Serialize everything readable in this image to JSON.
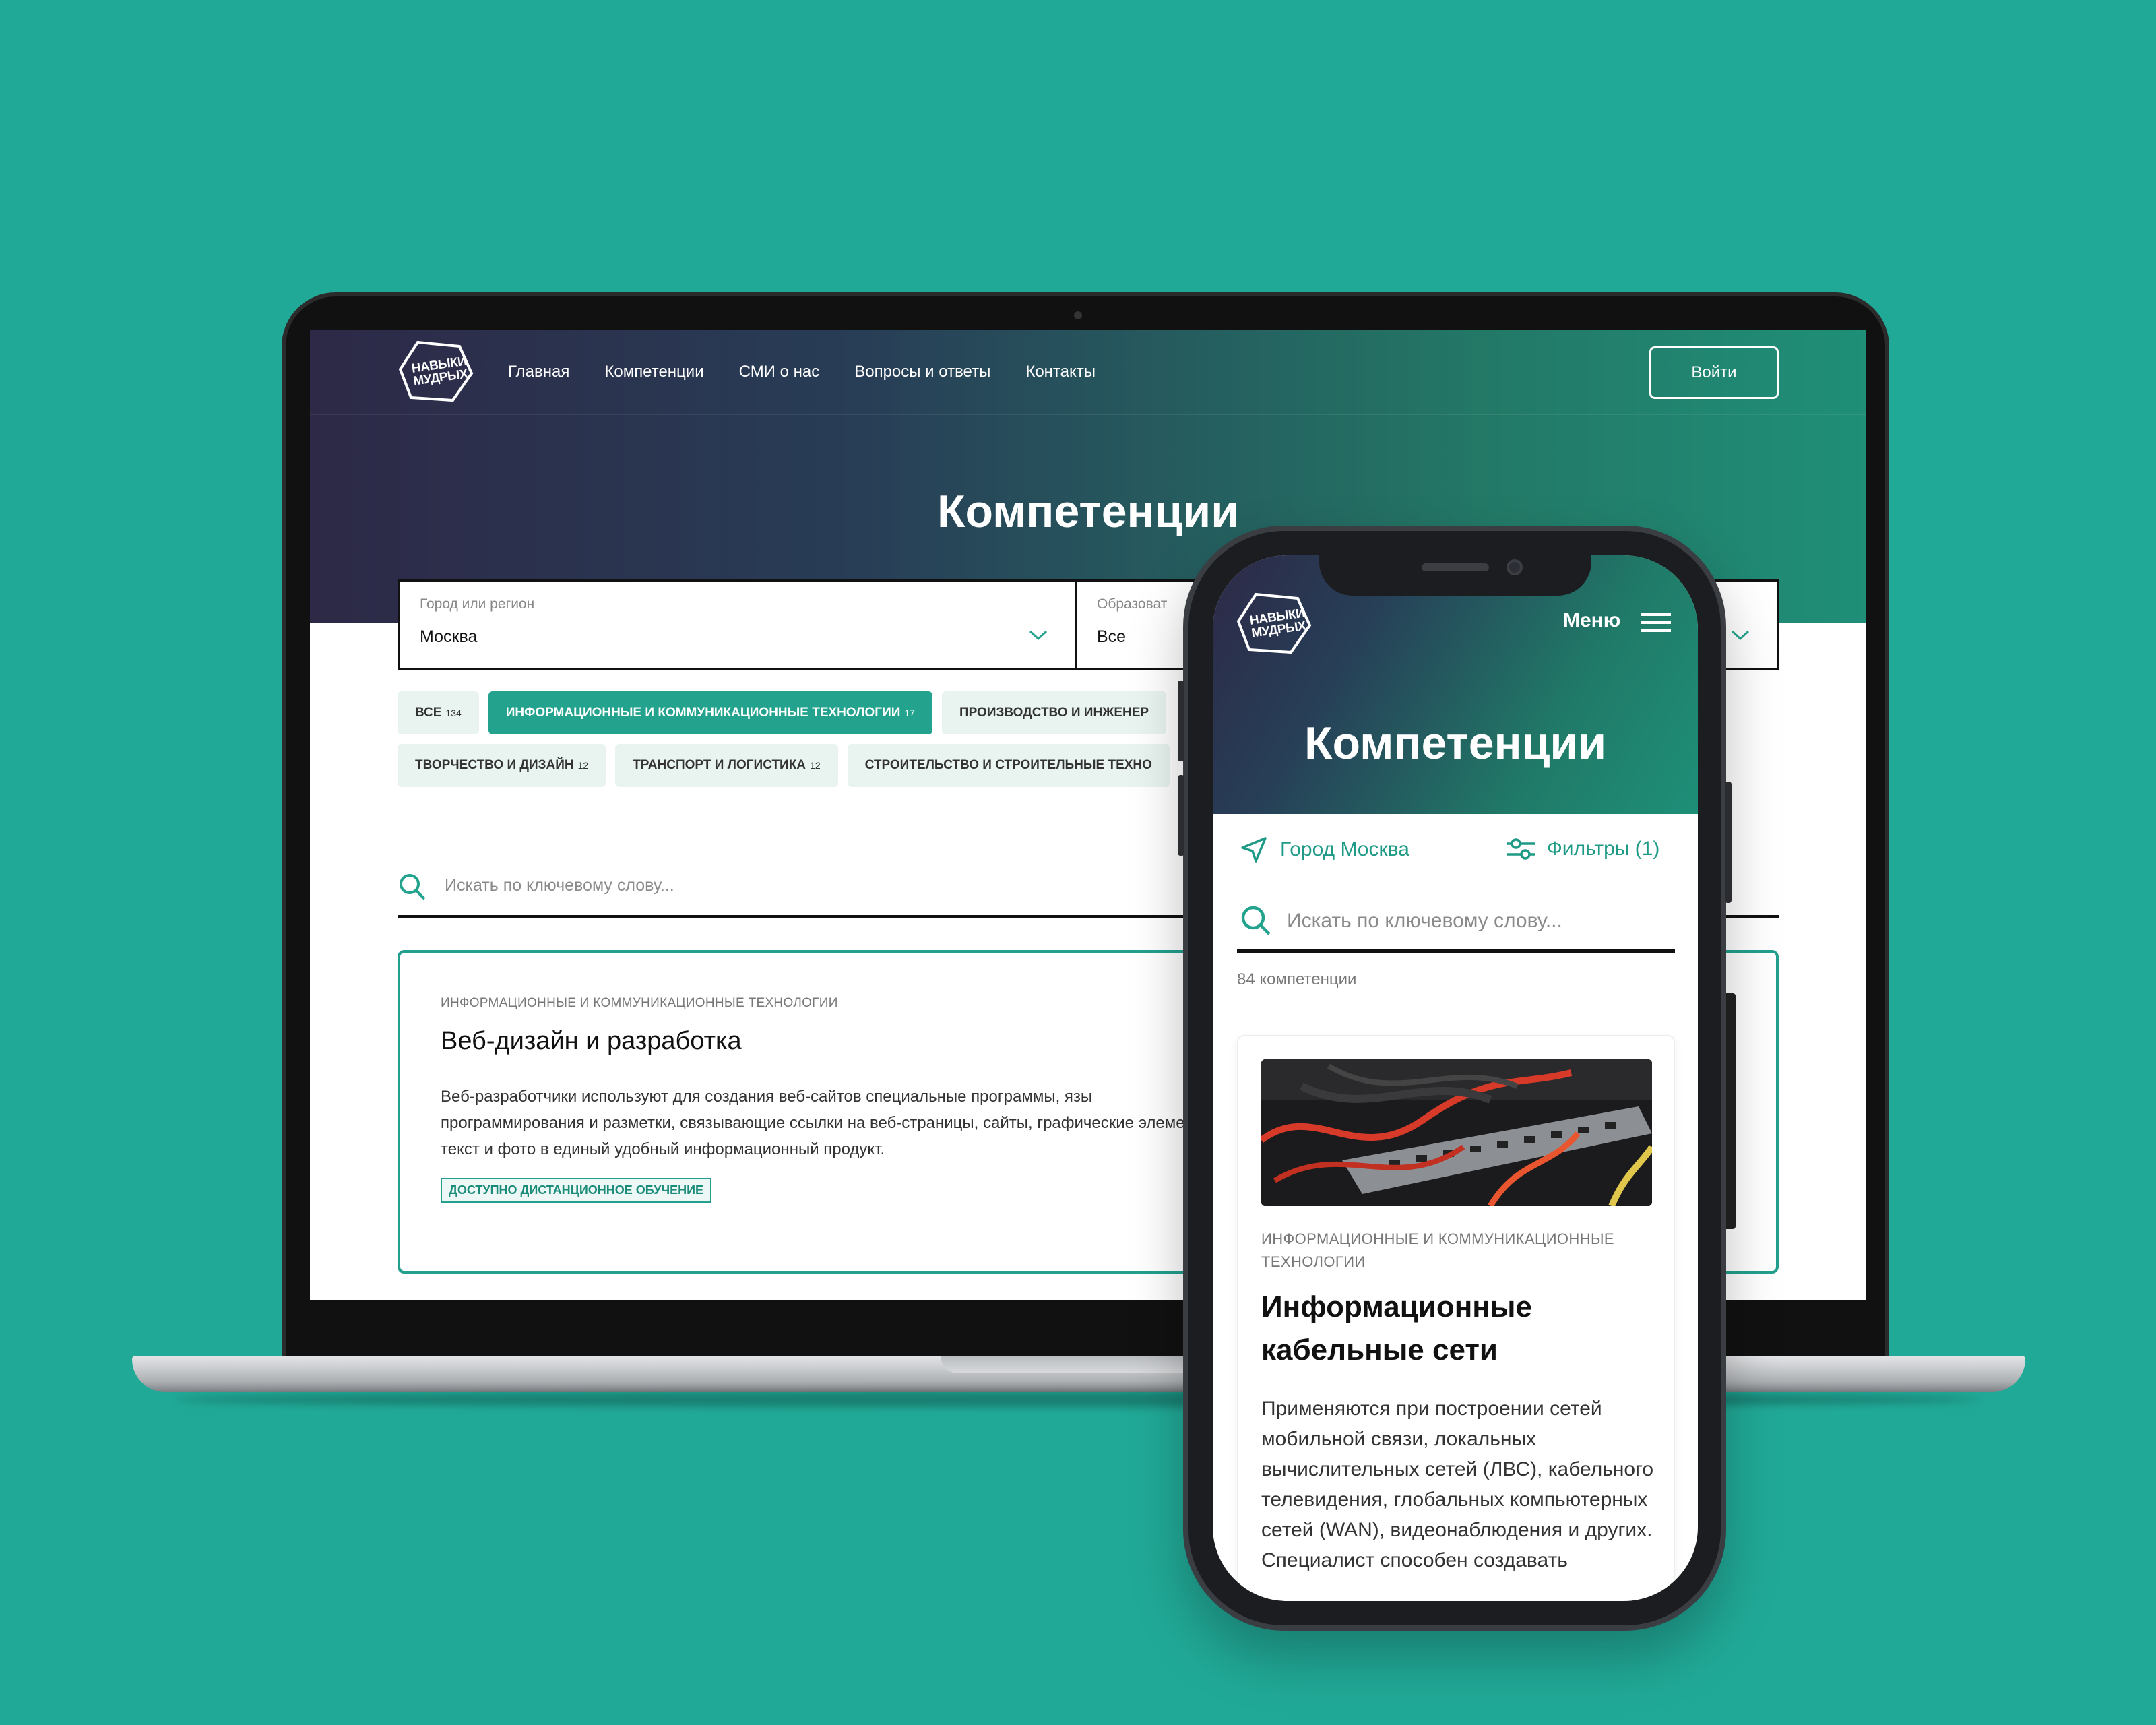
{
  "brand": {
    "logo_text": "НАВЫКИ МУДРЫХ",
    "accent": "#23a38e",
    "background": "#21a997"
  },
  "desktop": {
    "nav": [
      "Главная",
      "Компетенции",
      "СМИ о нас",
      "Вопросы и ответы",
      "Контакты"
    ],
    "login_label": "Войти",
    "page_title": "Компетенции",
    "filters": {
      "city": {
        "caption": "Город или регион",
        "value": "Москва"
      },
      "education": {
        "caption": "Образоват",
        "value": "Все"
      }
    },
    "chips_row1": [
      {
        "label": "Все",
        "count": "134",
        "active": false
      },
      {
        "label": "Информационные и коммуникационные технологии",
        "count": "17",
        "active": true
      },
      {
        "label": "Производство и инженер",
        "count": "",
        "active": false
      }
    ],
    "chips_row2": [
      {
        "label": "Творчество и дизайн",
        "count": "12",
        "active": false
      },
      {
        "label": "Транспорт и логистика",
        "count": "12",
        "active": false
      },
      {
        "label": "Строительство и строительные техно",
        "count": "",
        "active": false
      }
    ],
    "search_placeholder": "Искать по ключевому слову...",
    "card": {
      "category": "Информационные и коммуникационные технологии",
      "title": "Веб-дизайн и разработка",
      "description": "Веб-разработчики используют для создания веб-сайтов специальные программы, язы программирования и разметки, связывающие ссылки на веб-страницы, сайты, графические элементы, текст и фото в единый удобный информационный продукт.",
      "badge": "Доступно дистанционное обучение"
    }
  },
  "mobile": {
    "menu_label": "Меню",
    "page_title": "Компетенции",
    "city_label": "Город Москва",
    "filters_label": "Фильтры (1)",
    "search_placeholder": "Искать по ключевому слову...",
    "count_label": "84 компетенции",
    "card": {
      "category": "Информационные и коммуникационные технологии",
      "title": "Информационные кабельные сети",
      "description": "Применяются при построении сетей мобильной связи, локальных вычислительных сетей (ЛВС), кабельного телевидения, глобальных компьютерных сетей (WAN), видеонаблюдения и других. Специалист способен создавать"
    }
  }
}
